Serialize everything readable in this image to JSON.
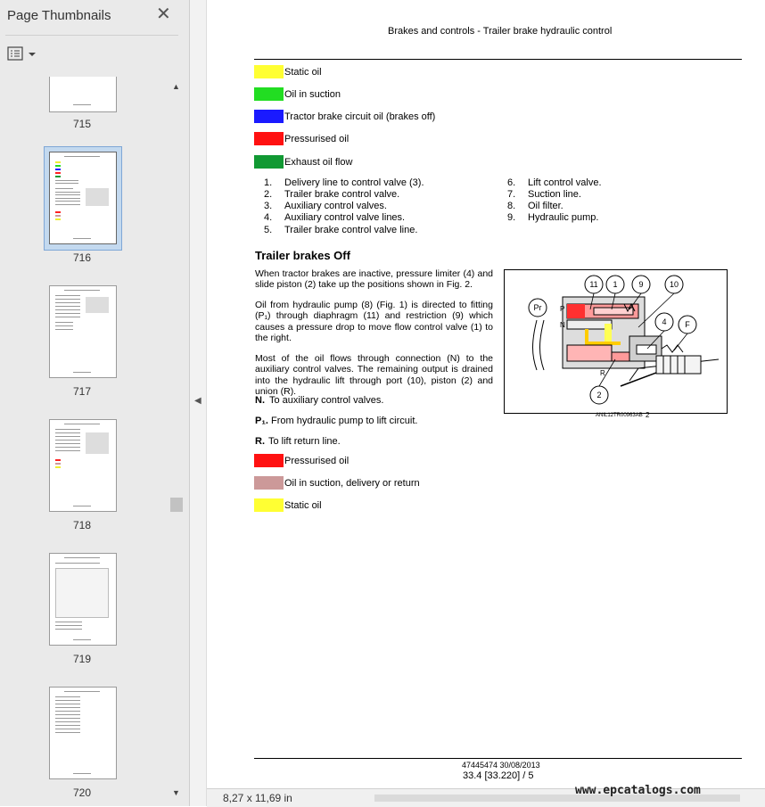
{
  "sidebar": {
    "title": "Page Thumbnails",
    "close_icon": "close-icon",
    "options_icon": "thumbnail-options-icon",
    "thumbnails": [
      {
        "label": "715"
      },
      {
        "label": "716",
        "selected": true
      },
      {
        "label": "717"
      },
      {
        "label": "718"
      },
      {
        "label": "719"
      },
      {
        "label": "720"
      }
    ]
  },
  "status": {
    "page_size": "8,27 x 11,69 in"
  },
  "watermark": "www.epcatalogs.com",
  "document": {
    "header": "Brakes and controls - Trailer brake hydraulic control",
    "legend_top": [
      {
        "color": "#ffff33",
        "label": "Static oil"
      },
      {
        "color": "#22dd22",
        "label": "Oil in suction"
      },
      {
        "color": "#1a1aff",
        "label": "Tractor brake circuit oil (brakes off)"
      },
      {
        "color": "#ff1111",
        "label": "Pressurised oil"
      },
      {
        "color": "#119933",
        "label": "Exhaust oil flow"
      }
    ],
    "list_left": [
      {
        "num": "1.",
        "text": "Delivery line to control valve (3)."
      },
      {
        "num": "2.",
        "text": "Trailer brake control valve."
      },
      {
        "num": "3.",
        "text": "Auxiliary control valves."
      },
      {
        "num": "4.",
        "text": "Auxiliary control valve lines."
      },
      {
        "num": "5.",
        "text": "Trailer brake control valve line."
      }
    ],
    "list_right": [
      {
        "num": "6.",
        "text": "Lift control valve."
      },
      {
        "num": "7.",
        "text": "Suction line."
      },
      {
        "num": "8.",
        "text": "Oil filter."
      },
      {
        "num": "9.",
        "text": "Hydraulic pump."
      }
    ],
    "section_title": "Trailer brakes Off",
    "paragraphs": [
      "When tractor brakes are inactive, pressure limiter (4) and slide piston (2) take up the positions shown in Fig. 2.",
      "Oil from hydraulic pump (8) (Fig. 1) is directed to fitting (P₁) through diaphragm (11) and restriction (9) which causes a pressure drop to move flow control valve (1) to the right.",
      "Most of the oil flows through connection (N) to the auxiliary control valves. The remaining output is drained into the hydraulic lift through port (10), piston (2) and union (R)."
    ],
    "notes": [
      {
        "key": "N.",
        "text": "To auxiliary control valves."
      },
      {
        "key": "P₁.",
        "text": "From hydraulic pump to lift circuit."
      },
      {
        "key": "R.",
        "text": "To lift return line."
      }
    ],
    "legend_bottom": [
      {
        "color": "#ff1111",
        "label": "Pressurised oil"
      },
      {
        "color": "#cc9999",
        "label": "Oil in suction, delivery or return"
      },
      {
        "color": "#ffff33",
        "label": "Static oil"
      }
    ],
    "figure": {
      "callouts": [
        "11",
        "1",
        "9",
        "10",
        "Pr",
        "4",
        "F",
        "2"
      ],
      "port_labels": [
        "P",
        "N",
        "R"
      ],
      "code": "ANIL12TR00963AB",
      "number": "2"
    },
    "footer": {
      "doc_ref": "47445474 30/08/2013",
      "page_ref": "33.4 [33.220] / 5"
    }
  }
}
